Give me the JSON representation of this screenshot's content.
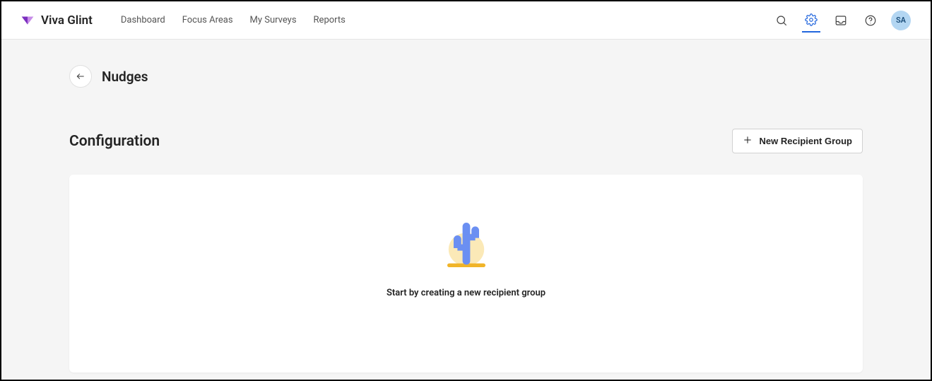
{
  "brand": {
    "name": "Viva Glint"
  },
  "nav": {
    "items": [
      {
        "label": "Dashboard"
      },
      {
        "label": "Focus Areas"
      },
      {
        "label": "My Surveys"
      },
      {
        "label": "Reports"
      }
    ]
  },
  "header": {
    "avatar_initials": "SA"
  },
  "page": {
    "title": "Nudges"
  },
  "section": {
    "title": "Configuration",
    "new_group_label": "New Recipient Group"
  },
  "empty_state": {
    "message": "Start by creating a new recipient group"
  }
}
